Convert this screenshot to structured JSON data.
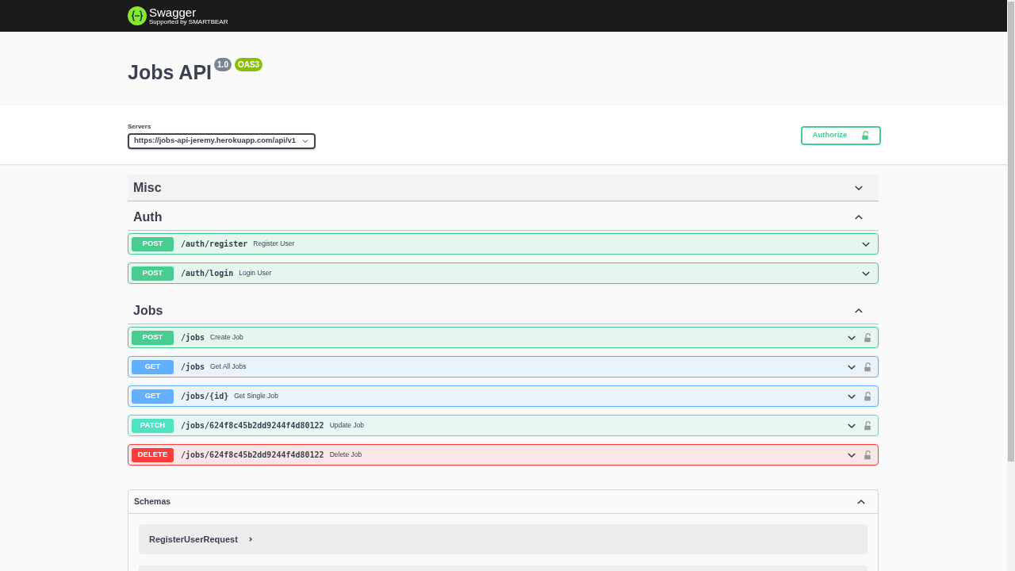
{
  "topbar": {
    "brand": "Swagger",
    "tagline": "Supported by SMARTBEAR"
  },
  "info": {
    "title": "Jobs API",
    "version": "1.0",
    "spec": "OAS3"
  },
  "servers": {
    "label": "Servers",
    "value": "https://jobs-api-jeremy.herokuapp.com/api/v1"
  },
  "authorize_button": "Authorize",
  "tags": [
    {
      "name": "Misc",
      "expanded": false
    },
    {
      "name": "Auth",
      "expanded": true,
      "operations": [
        {
          "method": "POST",
          "path": "/auth/register",
          "summary": "Register User",
          "secured": false
        },
        {
          "method": "POST",
          "path": "/auth/login",
          "summary": "Login User",
          "secured": false
        }
      ]
    },
    {
      "name": "Jobs",
      "expanded": true,
      "operations": [
        {
          "method": "POST",
          "path": "/jobs",
          "summary": "Create Job",
          "secured": true
        },
        {
          "method": "GET",
          "path": "/jobs",
          "summary": "Get All Jobs",
          "secured": true
        },
        {
          "method": "GET",
          "path": "/jobs/{id}",
          "summary": "Get Single Job",
          "secured": true
        },
        {
          "method": "PATCH",
          "path": "/jobs/624f8c45b2dd9244f4d80122",
          "summary": "Update Job",
          "secured": true
        },
        {
          "method": "DELETE",
          "path": "/jobs/624f8c45b2dd9244f4d80122",
          "summary": "Delete Job",
          "secured": true
        }
      ]
    }
  ],
  "schemas": {
    "title": "Schemas",
    "expanded": true,
    "items": [
      {
        "name": "RegisterUserRequest"
      }
    ],
    "more_below": true
  }
}
